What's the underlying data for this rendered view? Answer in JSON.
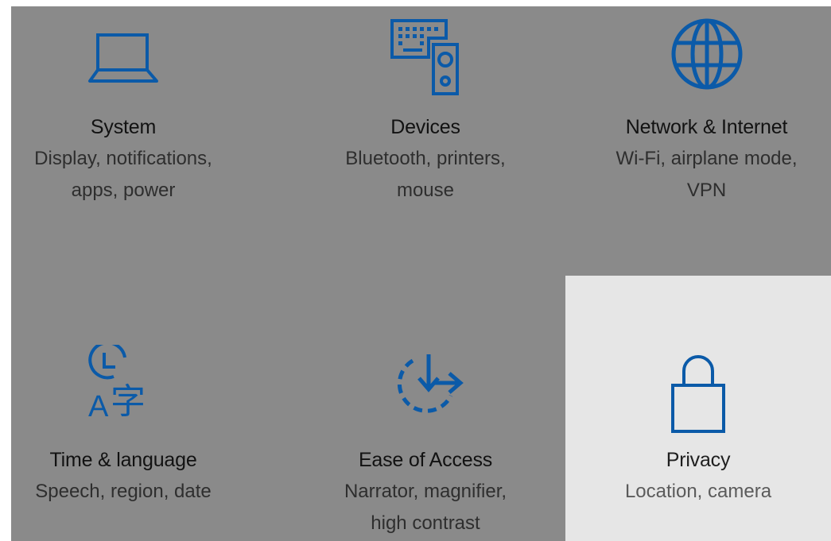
{
  "accent_color": "#0b5aa8",
  "selected_color": "#e6e6e6",
  "categories": [
    {
      "icon": "laptop-icon",
      "title": "System",
      "description": "Display, notifications, apps, power"
    },
    {
      "icon": "devices-icon",
      "title": "Devices",
      "description": "Bluetooth, printers, mouse"
    },
    {
      "icon": "globe-icon",
      "title": "Network & Internet",
      "description": "Wi-Fi, airplane mode, VPN"
    },
    {
      "icon": "time-language-icon",
      "title": "Time & language",
      "description": "Speech, region, date"
    },
    {
      "icon": "ease-of-access-icon",
      "title": "Ease of Access",
      "description": "Narrator, magnifier, high contrast"
    },
    {
      "icon": "lock-icon",
      "title": "Privacy",
      "description": "Location, camera",
      "selected": true
    }
  ]
}
